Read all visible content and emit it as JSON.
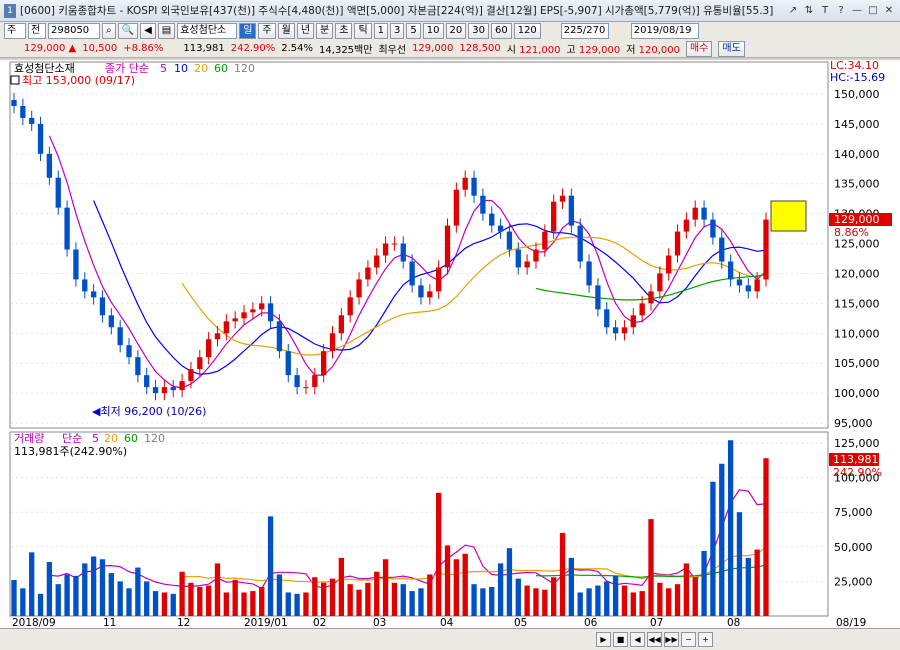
{
  "title_bar": {
    "icon": "1",
    "text": "[0600] 키움종합차트 - KOSPI 외국인보유[437(천)] 주식수[4,480(천)] 액면[5,000] 자본금[224(억)] 결산[12월] EPS[-5,907] 시가총액[5,779(억)] 유통비율[55.3]",
    "buttons": [
      "↗",
      "⇅",
      "T",
      "?",
      "—",
      "□",
      "✕"
    ]
  },
  "toolbar": {
    "market": "주",
    "market_sub": "전",
    "code": "298050",
    "icons": [
      "search-icon",
      "zoom-icon",
      "speaker-icon",
      "list-icon"
    ],
    "stock_name": "효성첨단소",
    "periods": [
      "일",
      "주",
      "월",
      "년",
      "분",
      "초",
      "틱"
    ],
    "selected_period": "일",
    "minutes": [
      "1",
      "3",
      "5",
      "10",
      "20",
      "30",
      "60",
      "120"
    ],
    "count": "225/270",
    "date": "2019/08/19"
  },
  "quote": {
    "price": "129,000",
    "arrow": "▲",
    "change": "10,500",
    "change_pct": "+8.86%",
    "volume": "113,981",
    "volume_ratio": "242.90%",
    "turnover": "2.54%",
    "amount": "14,325백만",
    "priority": "최우선",
    "ask": "129,000",
    "bid": "128,500",
    "open_label": "시",
    "open": "121,000",
    "high_label": "고",
    "high": "129,000",
    "low_label": "저",
    "low": "120,000",
    "buy_button": "매수",
    "sell_button": "매도"
  },
  "price_panel": {
    "stock_label": "효성첨단소재",
    "indicator": "종가 단순",
    "ma_periods": [
      "5",
      "10",
      "20",
      "60",
      "120"
    ],
    "max_label": "최고 153,000 (09/17)",
    "min_label": "최저 96,200 (10/26)",
    "lc": "LC:34.10",
    "hc": "HC:-15.69",
    "current_price": "129,000",
    "current_pct": "8.86%",
    "y_ticks": [
      "150,000",
      "145,000",
      "140,000",
      "135,000",
      "130,000",
      "125,000",
      "120,000",
      "115,000",
      "110,000",
      "105,000",
      "100,000",
      "95,000"
    ]
  },
  "volume_panel": {
    "label": "거래량",
    "indicator": "단순",
    "ma_periods": [
      "5",
      "20",
      "60",
      "120"
    ],
    "current_label": "113,981주(242.90%)",
    "current_value": "113,981",
    "current_pct": "242.90%",
    "y_ticks": [
      "125,000",
      "100,000",
      "75,000",
      "50,000",
      "25,000"
    ]
  },
  "x_axis": [
    "2018/09",
    "11",
    "12",
    "2019/01",
    "02",
    "03",
    "04",
    "05",
    "06",
    "07",
    "08"
  ],
  "x_axis_end": "08/19",
  "nav_buttons": [
    "▶",
    "■",
    "◀",
    "◀◀",
    "▶▶",
    "−",
    "+"
  ],
  "colors": {
    "up": "#e00000",
    "down": "#0050c8",
    "ma5": "#c000c0",
    "ma10": "#0000ff",
    "ma20": "#e8a000",
    "ma60": "#00a000",
    "ma120": "#808080"
  },
  "chart_data": {
    "type": "candlestick",
    "open": [
      149000,
      148000,
      146000,
      145000,
      140000,
      136000,
      131000,
      124000,
      119000,
      117000,
      116000,
      113000,
      111000,
      108000,
      106000,
      103000,
      101000,
      100000,
      101000,
      100500,
      102000,
      104000,
      106000,
      109000,
      110000,
      112000,
      112500,
      113500,
      114000,
      115000,
      112000,
      107000,
      103000,
      101000,
      101000,
      103000,
      107000,
      110000,
      113000,
      116000,
      119000,
      121000,
      123000,
      125000,
      125000,
      122000,
      118000,
      116000,
      117000,
      121000,
      128000,
      134000,
      136000,
      133000,
      130000,
      128000,
      127000,
      124000,
      121000,
      122000,
      124000,
      127000,
      132000,
      133000,
      128000,
      122000,
      118000,
      114000,
      111000,
      110000,
      111000,
      113000,
      115000,
      117000,
      120000,
      123000,
      127000,
      129000,
      131000,
      129000,
      126000,
      122000,
      119000,
      118000,
      117000,
      119000
    ],
    "close": [
      148000,
      146000,
      145000,
      140000,
      136000,
      131000,
      124000,
      119000,
      117000,
      116000,
      113000,
      111000,
      108000,
      106000,
      103000,
      101000,
      100000,
      101000,
      100500,
      102000,
      104000,
      106000,
      109000,
      110000,
      112000,
      112500,
      113500,
      114000,
      115000,
      112000,
      107000,
      103000,
      101000,
      101000,
      103000,
      107000,
      110000,
      113000,
      116000,
      119000,
      121000,
      123000,
      125000,
      125000,
      122000,
      118000,
      116000,
      117000,
      121000,
      128000,
      134000,
      136000,
      133000,
      130000,
      128000,
      127000,
      124000,
      121000,
      122000,
      124000,
      127000,
      132000,
      133000,
      128000,
      122000,
      118000,
      114000,
      111000,
      110000,
      111000,
      113000,
      115000,
      117000,
      120000,
      123000,
      127000,
      129000,
      131000,
      129000,
      126000,
      122000,
      119000,
      118000,
      117000,
      119000,
      129000
    ],
    "volume": [
      26000,
      20000,
      46000,
      16000,
      39000,
      23000,
      30000,
      29000,
      38000,
      43000,
      41000,
      31000,
      25000,
      20000,
      35000,
      25000,
      18000,
      17000,
      16000,
      32000,
      24000,
      21000,
      22000,
      38000,
      17000,
      26000,
      17000,
      18000,
      21000,
      72000,
      30000,
      17000,
      16000,
      17000,
      28000,
      24000,
      27000,
      42000,
      23000,
      19000,
      24000,
      32000,
      41000,
      24000,
      23000,
      18000,
      20000,
      30000,
      89000,
      51000,
      41000,
      45000,
      23000,
      20000,
      21000,
      38000,
      49000,
      27000,
      22000,
      20000,
      19000,
      28000,
      60000,
      42000,
      17000,
      20000,
      22000,
      25000,
      29000,
      22000,
      17000,
      18000,
      70000,
      24000,
      20000,
      23000,
      38000,
      28000,
      47000,
      97000,
      110000,
      127000,
      75000,
      42000,
      48000,
      113981
    ]
  }
}
